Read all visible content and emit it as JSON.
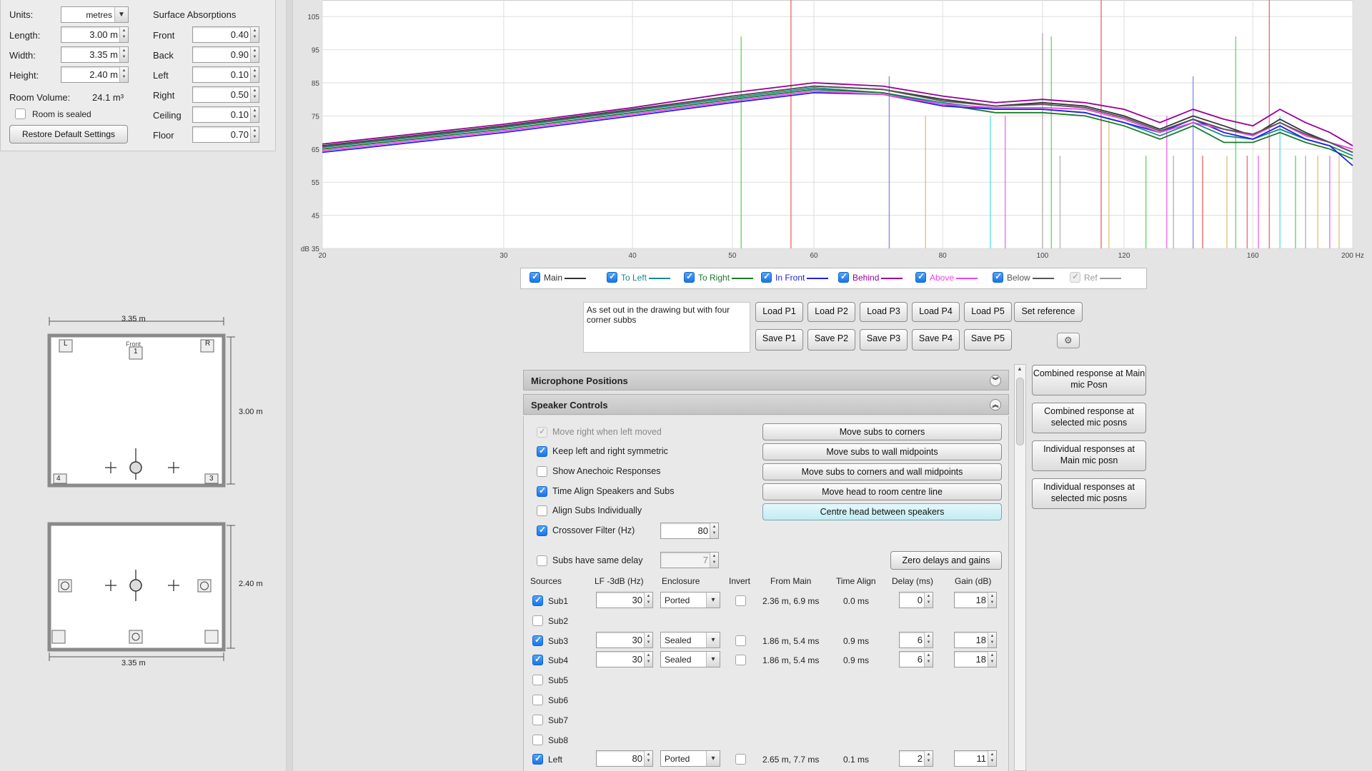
{
  "room": {
    "units_label": "Units:",
    "units_value": "metres",
    "length_label": "Length:",
    "length_value": "3.00 m",
    "width_label": "Width:",
    "width_value": "3.35 m",
    "height_label": "Height:",
    "height_value": "2.40 m",
    "volume_label": "Room Volume:",
    "volume_value": "24.1 m³",
    "sealed_label": "Room is sealed",
    "restore_label": "Restore Default Settings",
    "absorptions_title": "Surface Absorptions",
    "surfaces": [
      {
        "label": "Front",
        "value": "0.40"
      },
      {
        "label": "Back",
        "value": "0.90"
      },
      {
        "label": "Left",
        "value": "0.10"
      },
      {
        "label": "Right",
        "value": "0.50"
      },
      {
        "label": "Ceiling",
        "value": "0.10"
      },
      {
        "label": "Floor",
        "value": "0.70"
      }
    ]
  },
  "plan": {
    "top_width": "3.35 m",
    "top_depth": "3.00 m",
    "front_label": "Front",
    "speaker_labels": [
      "L",
      "R",
      "1",
      "4",
      "3"
    ],
    "side_height": "2.40 m",
    "side_width": "3.35 m"
  },
  "chart_data": {
    "type": "line",
    "x_scale": "log",
    "xlim": [
      20,
      200
    ],
    "ylim": [
      35,
      110
    ],
    "x_ticks": [
      "20",
      "30",
      "40",
      "50",
      "60",
      "80",
      "100",
      "120",
      "160",
      "200 Hz"
    ],
    "y_ticks": [
      "105",
      "95",
      "85",
      "75",
      "65",
      "55",
      "45",
      "dB 35"
    ],
    "x_tick_values": [
      20,
      30,
      40,
      50,
      60,
      80,
      100,
      120,
      160,
      200
    ],
    "y_tick_values": [
      105,
      95,
      85,
      75,
      65,
      55,
      45,
      35
    ],
    "grid": true,
    "series": [
      {
        "name": "Main",
        "color": "#333333",
        "x": [
          20,
          30,
          40,
          50,
          60,
          70,
          80,
          90,
          100,
          110,
          120,
          130,
          140,
          150,
          160,
          170,
          180,
          190,
          200
        ],
        "y": [
          66,
          72,
          77,
          81,
          84,
          83,
          80,
          78,
          79,
          78,
          75,
          71,
          75,
          72,
          69,
          74,
          70,
          67,
          64
        ]
      },
      {
        "name": "To Left",
        "color": "#1a8a8a",
        "x": [
          20,
          30,
          40,
          50,
          60,
          70,
          80,
          90,
          100,
          110,
          120,
          130,
          140,
          150,
          160,
          170,
          180,
          190,
          200
        ],
        "y": [
          65.5,
          71.5,
          76.5,
          80.5,
          83.5,
          82,
          79,
          77,
          77,
          76,
          73,
          69,
          73,
          69,
          68,
          71,
          68,
          66,
          63
        ]
      },
      {
        "name": "To Right",
        "color": "#1a7a2a",
        "x": [
          20,
          30,
          40,
          50,
          60,
          70,
          80,
          90,
          100,
          110,
          120,
          130,
          140,
          150,
          160,
          170,
          180,
          190,
          200
        ],
        "y": [
          65,
          71,
          76,
          80,
          83,
          82,
          78.5,
          76,
          76,
          75,
          72,
          68,
          72,
          67,
          67,
          70,
          67,
          65,
          62
        ]
      },
      {
        "name": "In Front",
        "color": "#2222dd",
        "x": [
          20,
          30,
          40,
          50,
          60,
          70,
          80,
          90,
          100,
          110,
          120,
          130,
          140,
          150,
          160,
          170,
          180,
          190,
          200
        ],
        "y": [
          64,
          70,
          75,
          79,
          82,
          81.5,
          78,
          77,
          77,
          76,
          73,
          70,
          74,
          70,
          68,
          72,
          68,
          66,
          60
        ]
      },
      {
        "name": "Behind",
        "color": "#990099",
        "x": [
          20,
          30,
          40,
          50,
          60,
          70,
          80,
          90,
          100,
          110,
          120,
          130,
          140,
          150,
          160,
          170,
          180,
          190,
          200
        ],
        "y": [
          66.5,
          72.5,
          77.5,
          82,
          85,
          84,
          81,
          79,
          80,
          79,
          77,
          73,
          77,
          74,
          72,
          77,
          73,
          70,
          66
        ]
      },
      {
        "name": "Above",
        "color": "#ee44ee",
        "x": [
          20,
          30,
          40,
          50,
          60,
          70,
          80,
          90,
          100,
          110,
          120,
          130,
          140,
          150,
          160,
          170,
          180,
          190,
          200
        ],
        "y": [
          64.5,
          70.5,
          75.5,
          79.5,
          82.5,
          81.5,
          78.5,
          77.5,
          77.5,
          77,
          74,
          70,
          73,
          71,
          69,
          73,
          69,
          67,
          65
        ]
      },
      {
        "name": "Below",
        "color": "#555555",
        "x": [
          20,
          30,
          40,
          50,
          60,
          70,
          80,
          90,
          100,
          110,
          120,
          130,
          140,
          150,
          160,
          170,
          180,
          190,
          200
        ],
        "y": [
          65.8,
          71.8,
          76.8,
          81,
          84,
          83,
          79.5,
          78,
          78.5,
          77.5,
          74.5,
          70.5,
          74,
          71,
          69.5,
          73,
          69.5,
          67,
          64
        ]
      }
    ],
    "modes": [
      {
        "x": 51,
        "top": 99,
        "color": "#55cc55"
      },
      {
        "x": 57,
        "top": 110,
        "color": "#ee5555"
      },
      {
        "x": 71,
        "top": 87,
        "color": "#7777ee"
      },
      {
        "x": 77,
        "top": 75,
        "color": "#ddbb66"
      },
      {
        "x": 89,
        "top": 75,
        "color": "#44dddd"
      },
      {
        "x": 92,
        "top": 75,
        "color": "#ee55ee"
      },
      {
        "x": 100,
        "top": 100,
        "color": "#aaaaaa"
      },
      {
        "x": 102,
        "top": 99,
        "color": "#55cc55"
      },
      {
        "x": 104,
        "top": 63,
        "color": "#aaaaaa"
      },
      {
        "x": 114,
        "top": 110,
        "color": "#ee5555"
      },
      {
        "x": 116,
        "top": 75,
        "color": "#ddbb66"
      },
      {
        "x": 126,
        "top": 63,
        "color": "#55cc55"
      },
      {
        "x": 132,
        "top": 75,
        "color": "#ee55ee"
      },
      {
        "x": 134,
        "top": 63,
        "color": "#aaaaaa"
      },
      {
        "x": 140,
        "top": 87,
        "color": "#7777ee"
      },
      {
        "x": 143,
        "top": 63,
        "color": "#ee5555"
      },
      {
        "x": 151,
        "top": 63,
        "color": "#ddbb66"
      },
      {
        "x": 154,
        "top": 99,
        "color": "#55cc55"
      },
      {
        "x": 158,
        "top": 63,
        "color": "#ee5555"
      },
      {
        "x": 162,
        "top": 63,
        "color": "#ee55ee"
      },
      {
        "x": 166,
        "top": 110,
        "color": "#ee5555"
      },
      {
        "x": 170,
        "top": 75,
        "color": "#44dddd"
      },
      {
        "x": 176,
        "top": 63,
        "color": "#55cc55"
      },
      {
        "x": 180,
        "top": 63,
        "color": "#aaaaaa"
      },
      {
        "x": 185,
        "top": 63,
        "color": "#ddbb66"
      },
      {
        "x": 190,
        "top": 63,
        "color": "#ee55ee"
      },
      {
        "x": 194,
        "top": 63,
        "color": "#ddbb66"
      }
    ]
  },
  "legend": [
    {
      "label": "Main",
      "checked": true,
      "color": "#333333"
    },
    {
      "label": "To Left",
      "checked": true,
      "color": "#1a8a8a"
    },
    {
      "label": "To Right",
      "checked": true,
      "color": "#1a7a2a"
    },
    {
      "label": "In Front",
      "checked": true,
      "color": "#2222dd"
    },
    {
      "label": "Behind",
      "checked": true,
      "color": "#990099"
    },
    {
      "label": "Above",
      "checked": true,
      "color": "#ee44ee"
    },
    {
      "label": "Below",
      "checked": true,
      "color": "#555555"
    },
    {
      "label": "Ref",
      "checked": false,
      "color": "#999999"
    }
  ],
  "notes": "As set out in the drawing but with four corner subbs",
  "presets": {
    "load": [
      "Load P1",
      "Load P2",
      "Load P3",
      "Load P4",
      "Load P5"
    ],
    "save": [
      "Save P1",
      "Save P2",
      "Save P3",
      "Save P4",
      "Save P5"
    ],
    "set_reference": "Set reference"
  },
  "sections": {
    "mic": "Microphone Positions",
    "speaker": "Speaker Controls"
  },
  "right_buttons": [
    "Combined response at Main mic Posn",
    "Combined response at selected mic posns",
    "Individual responses at Main mic posn",
    "Individual responses at selected mic posns"
  ],
  "options": [
    {
      "label": "Move right when left moved",
      "state": "disabled"
    },
    {
      "label": "Keep left and right symmetric",
      "state": "on"
    },
    {
      "label": "Show Anechoic Responses",
      "state": "off"
    },
    {
      "label": "Time Align Speakers and Subs",
      "state": "on"
    },
    {
      "label": "Align Subs Individually",
      "state": "off"
    },
    {
      "label": "Crossover Filter (Hz)",
      "state": "on"
    }
  ],
  "crossover_value": "80",
  "same_delay_label": "Subs have same delay",
  "same_delay_value": "7",
  "action_buttons": [
    "Move subs to corners",
    "Move subs to wall midpoints",
    "Move subs to corners and wall midpoints",
    "Move head to room centre line",
    "Centre head between speakers"
  ],
  "zero_button": "Zero delays and gains",
  "table_headers": [
    "Sources",
    "LF -3dB (Hz)",
    "Enclosure",
    "Invert",
    "From Main",
    "Time Align",
    "Delay (ms)",
    "Gain (dB)"
  ],
  "sources": [
    {
      "name": "Sub1",
      "checked": true,
      "lf": "30",
      "enclosure": "Ported",
      "from_main": "2.36 m, 6.9 ms",
      "time_align": "0.0 ms",
      "delay": "0",
      "gain": "18"
    },
    {
      "name": "Sub2",
      "checked": false
    },
    {
      "name": "Sub3",
      "checked": true,
      "lf": "30",
      "enclosure": "Sealed",
      "from_main": "1.86 m, 5.4 ms",
      "time_align": "0.9 ms",
      "delay": "6",
      "gain": "18"
    },
    {
      "name": "Sub4",
      "checked": true,
      "lf": "30",
      "enclosure": "Sealed",
      "from_main": "1.86 m, 5.4 ms",
      "time_align": "0.9 ms",
      "delay": "6",
      "gain": "18"
    },
    {
      "name": "Sub5",
      "checked": false
    },
    {
      "name": "Sub6",
      "checked": false
    },
    {
      "name": "Sub7",
      "checked": false
    },
    {
      "name": "Sub8",
      "checked": false
    },
    {
      "name": "Left",
      "checked": true,
      "lf": "80",
      "enclosure": "Ported",
      "from_main": "2.65 m, 7.7 ms",
      "time_align": "0.1 ms",
      "delay": "2",
      "gain": "11"
    }
  ]
}
